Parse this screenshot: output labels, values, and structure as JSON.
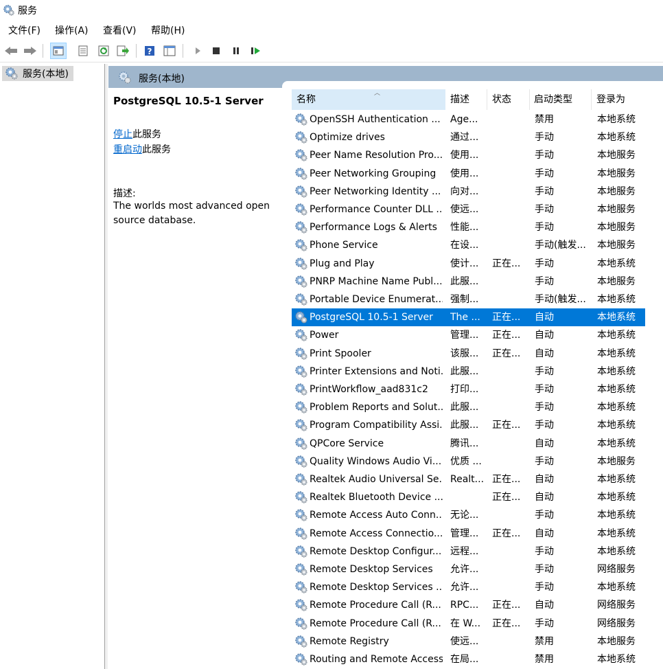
{
  "window": {
    "title": "服务"
  },
  "menu": [
    "文件(F)",
    "操作(A)",
    "查看(V)",
    "帮助(H)"
  ],
  "toolbar_icons": [
    "back-arrow-icon",
    "forward-arrow-icon",
    "show-hide-console-tree-icon",
    "properties-icon",
    "refresh-icon",
    "export-list-icon",
    "help-icon",
    "show-pane-icon",
    "start-service-icon",
    "stop-service-icon",
    "pause-service-icon",
    "resume-service-icon"
  ],
  "tree": {
    "item_label": "服务(本地)"
  },
  "main_header": {
    "label": "服务(本地)"
  },
  "details": {
    "service_name": "PostgreSQL 10.5-1 Server",
    "stop_link": "停止",
    "stop_suffix": "此服务",
    "restart_link": "重启动",
    "restart_suffix": "此服务",
    "desc_label": "描述:",
    "desc_text": "The worlds most advanced open source database."
  },
  "columns": {
    "name": "名称",
    "desc": "描述",
    "status": "状态",
    "start": "启动类型",
    "logon": "登录为"
  },
  "colors": {
    "selected": "#0078d7",
    "header_band": "#9fb6cc",
    "link": "#0066cc"
  },
  "selected_index": 11,
  "services": [
    {
      "name": "OpenSSH Authentication ...",
      "desc": "Age...",
      "status": "",
      "start": "禁用",
      "logon": "本地系统"
    },
    {
      "name": "Optimize drives",
      "desc": "通过...",
      "status": "",
      "start": "手动",
      "logon": "本地系统"
    },
    {
      "name": "Peer Name Resolution Pro...",
      "desc": "使用...",
      "status": "",
      "start": "手动",
      "logon": "本地服务"
    },
    {
      "name": "Peer Networking Grouping",
      "desc": "使用...",
      "status": "",
      "start": "手动",
      "logon": "本地服务"
    },
    {
      "name": "Peer Networking Identity ...",
      "desc": "向对...",
      "status": "",
      "start": "手动",
      "logon": "本地服务"
    },
    {
      "name": "Performance Counter DLL ...",
      "desc": "使远...",
      "status": "",
      "start": "手动",
      "logon": "本地服务"
    },
    {
      "name": "Performance Logs & Alerts",
      "desc": "性能...",
      "status": "",
      "start": "手动",
      "logon": "本地服务"
    },
    {
      "name": "Phone Service",
      "desc": "在设...",
      "status": "",
      "start": "手动(触发...",
      "logon": "本地服务"
    },
    {
      "name": "Plug and Play",
      "desc": "使计...",
      "status": "正在...",
      "start": "手动",
      "logon": "本地系统"
    },
    {
      "name": "PNRP Machine Name Publ...",
      "desc": "此服...",
      "status": "",
      "start": "手动",
      "logon": "本地服务"
    },
    {
      "name": "Portable Device Enumerat...",
      "desc": "强制...",
      "status": "",
      "start": "手动(触发...",
      "logon": "本地系统"
    },
    {
      "name": "PostgreSQL 10.5-1 Server",
      "desc": "The ...",
      "status": "正在...",
      "start": "自动",
      "logon": "本地系统"
    },
    {
      "name": "Power",
      "desc": "管理...",
      "status": "正在...",
      "start": "自动",
      "logon": "本地系统"
    },
    {
      "name": "Print Spooler",
      "desc": "该服...",
      "status": "正在...",
      "start": "自动",
      "logon": "本地系统"
    },
    {
      "name": "Printer Extensions and Noti...",
      "desc": "此服...",
      "status": "",
      "start": "手动",
      "logon": "本地系统"
    },
    {
      "name": "PrintWorkflow_aad831c2",
      "desc": "打印...",
      "status": "",
      "start": "手动",
      "logon": "本地系统"
    },
    {
      "name": "Problem Reports and Solut...",
      "desc": "此服...",
      "status": "",
      "start": "手动",
      "logon": "本地系统"
    },
    {
      "name": "Program Compatibility Assi...",
      "desc": "此服...",
      "status": "正在...",
      "start": "手动",
      "logon": "本地系统"
    },
    {
      "name": "QPCore Service",
      "desc": "腾讯...",
      "status": "",
      "start": "自动",
      "logon": "本地系统"
    },
    {
      "name": "Quality Windows Audio Vi...",
      "desc": "优质 ...",
      "status": "",
      "start": "手动",
      "logon": "本地服务"
    },
    {
      "name": "Realtek Audio Universal Se...",
      "desc": "Realt...",
      "status": "正在...",
      "start": "自动",
      "logon": "本地系统"
    },
    {
      "name": "Realtek Bluetooth Device ...",
      "desc": "",
      "status": "正在...",
      "start": "自动",
      "logon": "本地系统"
    },
    {
      "name": "Remote Access Auto Conn...",
      "desc": "无论...",
      "status": "",
      "start": "手动",
      "logon": "本地系统"
    },
    {
      "name": "Remote Access Connectio...",
      "desc": "管理...",
      "status": "正在...",
      "start": "自动",
      "logon": "本地系统"
    },
    {
      "name": "Remote Desktop Configur...",
      "desc": "远程...",
      "status": "",
      "start": "手动",
      "logon": "本地系统"
    },
    {
      "name": "Remote Desktop Services",
      "desc": "允许...",
      "status": "",
      "start": "手动",
      "logon": "网络服务"
    },
    {
      "name": "Remote Desktop Services ...",
      "desc": "允许...",
      "status": "",
      "start": "手动",
      "logon": "本地系统"
    },
    {
      "name": "Remote Procedure Call (R...",
      "desc": "RPC...",
      "status": "正在...",
      "start": "自动",
      "logon": "网络服务"
    },
    {
      "name": "Remote Procedure Call (R...",
      "desc": "在 W...",
      "status": "正在...",
      "start": "手动",
      "logon": "网络服务"
    },
    {
      "name": "Remote Registry",
      "desc": "使远...",
      "status": "",
      "start": "禁用",
      "logon": "本地服务"
    },
    {
      "name": "Routing and Remote Access",
      "desc": "在局...",
      "status": "",
      "start": "禁用",
      "logon": "本地系统"
    }
  ]
}
